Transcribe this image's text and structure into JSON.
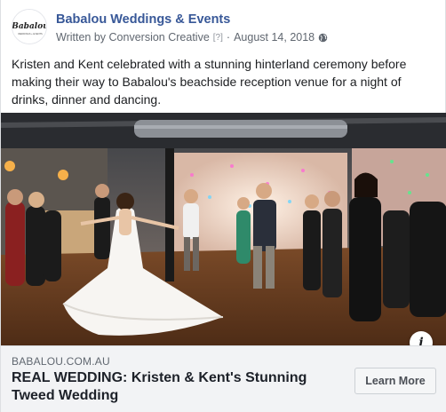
{
  "post": {
    "page_name": "Babalou Weddings & Events",
    "written_by_label": "Written by",
    "author": "Conversion Creative",
    "help_marker": "[?]",
    "separator": "·",
    "date": "August 14, 2018",
    "privacy_icon": "globe-icon",
    "text": "Kristen and Kent celebrated with a stunning hinterland ceremony before making their way to Babalou's beachside reception venue for a night of drinks, dinner and dancing."
  },
  "avatar": {
    "logo_word": "Babalou",
    "logo_subtext": "WEDDINGS + EVENTS"
  },
  "image": {
    "info_glyph": "i",
    "info_icon": "info-icon"
  },
  "link_preview": {
    "domain": "BABALOU.COM.AU",
    "title": "REAL WEDDING: Kristen & Kent's Stunning Tweed Wedding",
    "cta_label": "Learn More"
  },
  "colors": {
    "page_name": "#385898",
    "meta_text": "#606770",
    "footer_bg": "#f2f3f5",
    "button_bg": "#f5f6f7"
  }
}
